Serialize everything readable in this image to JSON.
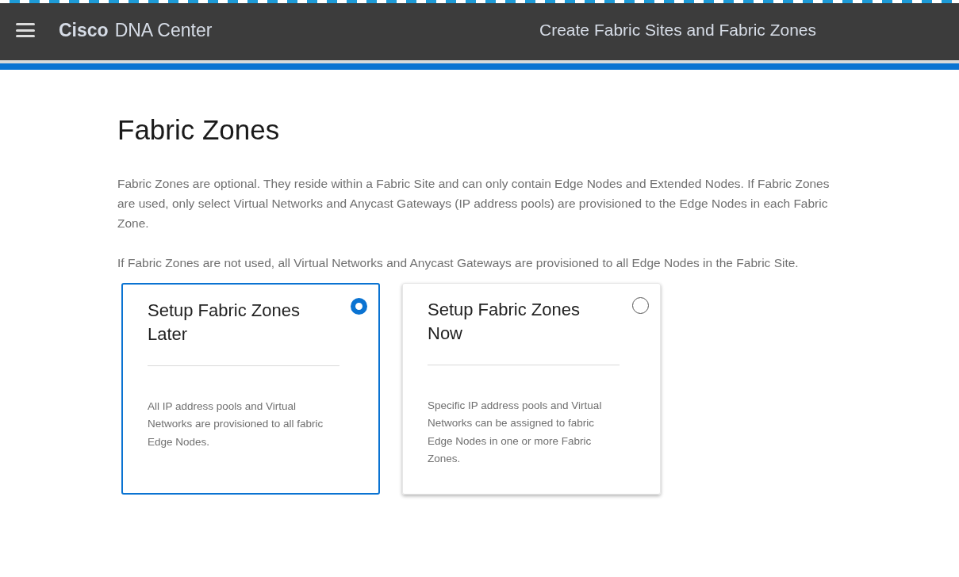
{
  "header": {
    "brand_bold": "Cisco",
    "brand": "DNA Center",
    "title": "Create Fabric Sites and Fabric Zones"
  },
  "page": {
    "heading": "Fabric Zones",
    "paragraphs": [
      "Fabric Zones are optional. They reside within a Fabric Site and can only contain Edge Nodes and Extended Nodes. If Fabric Zones are used, only select Virtual Networks and Anycast Gateways (IP address pools) are provisioned to the Edge Nodes in each Fabric Zone.",
      "If Fabric Zones are not used, all Virtual Networks and Anycast Gateways are provisioned to all Edge Nodes in the Fabric Site."
    ]
  },
  "options": [
    {
      "title": "Setup Fabric Zones Later",
      "description": "All IP address pools and Virtual Networks are provisioned to all fabric Edge Nodes.",
      "selected": true
    },
    {
      "title": "Setup Fabric Zones Now",
      "description": "Specific IP address pools and Virtual Networks can be assigned to fabric Edge Nodes in one or more Fabric Zones.",
      "selected": false
    }
  ]
}
